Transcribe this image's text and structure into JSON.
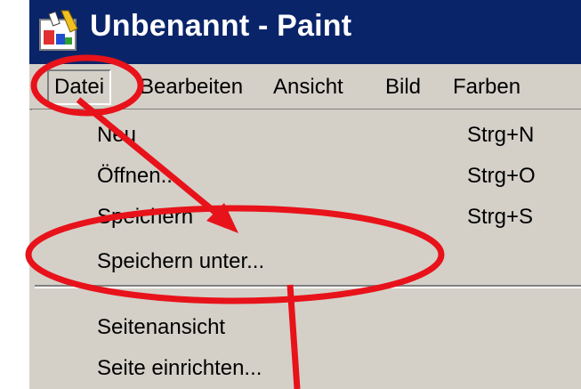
{
  "window": {
    "title": "Unbenannt - Paint"
  },
  "menubar": {
    "items": [
      {
        "label": "Datei"
      },
      {
        "label": "Bearbeiten"
      },
      {
        "label": "Ansicht"
      },
      {
        "label": "Bild"
      },
      {
        "label": "Farben"
      }
    ]
  },
  "file_menu": {
    "items": [
      {
        "label": "Neu",
        "shortcut": "Strg+N"
      },
      {
        "label": "Öffnen...",
        "shortcut": "Strg+O"
      },
      {
        "label": "Speichern",
        "shortcut": "Strg+S"
      },
      {
        "label": "Speichern unter...",
        "shortcut": ""
      },
      {
        "label": "Seitenansicht",
        "shortcut": ""
      },
      {
        "label": "Seite einrichten...",
        "shortcut": ""
      }
    ]
  },
  "annotation": {
    "color": "#e8121a"
  },
  "colors": {
    "titlebar": "#0a246a",
    "chrome": "#d4d0c8"
  }
}
